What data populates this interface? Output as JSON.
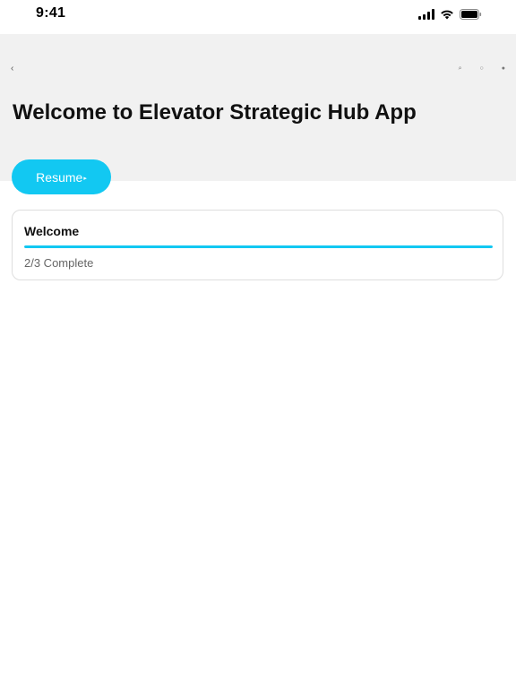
{
  "status_bar": {
    "time": "9:41",
    "icons": [
      "signal-icon",
      "wifi-icon",
      "battery-icon"
    ]
  },
  "nav": {
    "back_icon": "chevron-left-icon",
    "back_glyph": "‹",
    "actions": [
      {
        "name": "search-icon",
        "glyph": "⌕"
      },
      {
        "name": "bookmark-icon",
        "glyph": "○"
      },
      {
        "name": "more-icon",
        "glyph": "●"
      }
    ]
  },
  "header": {
    "title": "Welcome to Elevator Strategic Hub App"
  },
  "resume": {
    "label": "Resume",
    "arrow": "▸"
  },
  "card": {
    "title": "Welcome",
    "progress_text": "2/3 Complete",
    "progress_fraction": 1.0
  },
  "colors": {
    "accent": "#12c8f2",
    "header_background": "#f1f1f1",
    "card_border": "#dedede",
    "title_text": "#111111",
    "secondary_text": "#666666"
  }
}
